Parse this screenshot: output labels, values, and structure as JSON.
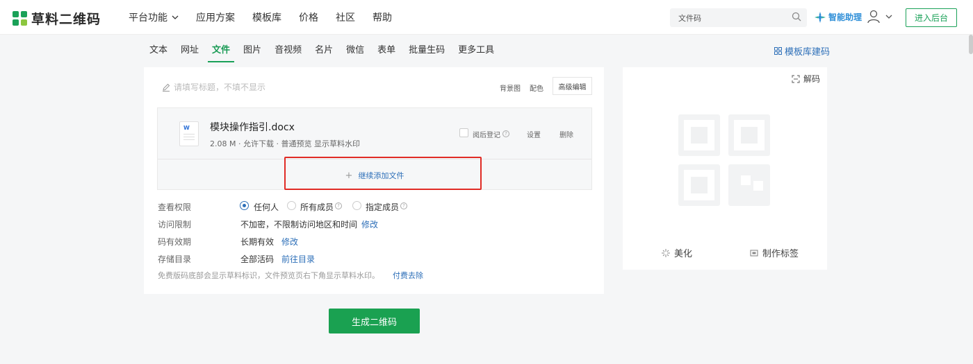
{
  "brand": {
    "name": "草料二维码",
    "colors": {
      "green": "#1aa158",
      "link": "#2d6fb8",
      "highlight": "#e02b25"
    }
  },
  "nav": {
    "items": [
      {
        "label": "平台功能",
        "has_dropdown": true
      },
      {
        "label": "应用方案"
      },
      {
        "label": "模板库"
      },
      {
        "label": "价格"
      },
      {
        "label": "社区"
      },
      {
        "label": "帮助"
      }
    ],
    "search": {
      "value": "文件码",
      "icon": "search-icon"
    },
    "assistant_label": "智能助理",
    "enter_button": "进入后台"
  },
  "tabs": {
    "items": [
      "文本",
      "网址",
      "文件",
      "图片",
      "音视频",
      "名片",
      "微信",
      "表单",
      "批量生码",
      "更多工具"
    ],
    "active": "文件",
    "template_link": "模板库建码"
  },
  "editor": {
    "title_placeholder": "请填写标题，不填不显示",
    "bg_button": "背景图",
    "color_button": "配色",
    "advanced_button": "高级编辑",
    "file": {
      "name": "模块操作指引.docx",
      "meta": "2.08 M · 允许下载 · 普通预览 显示草料水印",
      "icon_letter": "W",
      "checkbox_label": "阅后登记",
      "settings": "设置",
      "delete": "删除"
    },
    "add_file": "继续添加文件",
    "permissions": {
      "label": "查看权限",
      "options": [
        "任何人",
        "所有成员",
        "指定成员"
      ],
      "selected": "任何人"
    },
    "access": {
      "label": "访问限制",
      "value": "不加密，不限制访问地区和时间",
      "link": "修改"
    },
    "validity": {
      "label": "码有效期",
      "value": "长期有效",
      "link": "修改"
    },
    "storage": {
      "label": "存储目录",
      "value": "全部活码",
      "link": "前往目录"
    },
    "notice": "免费版码底部会显示草料标识，文件预览页右下角显示草料水印。",
    "notice_link": "付费去除",
    "generate_button": "生成二维码"
  },
  "preview": {
    "decode": "解码",
    "beautify": "美化",
    "make_label": "制作标签"
  }
}
